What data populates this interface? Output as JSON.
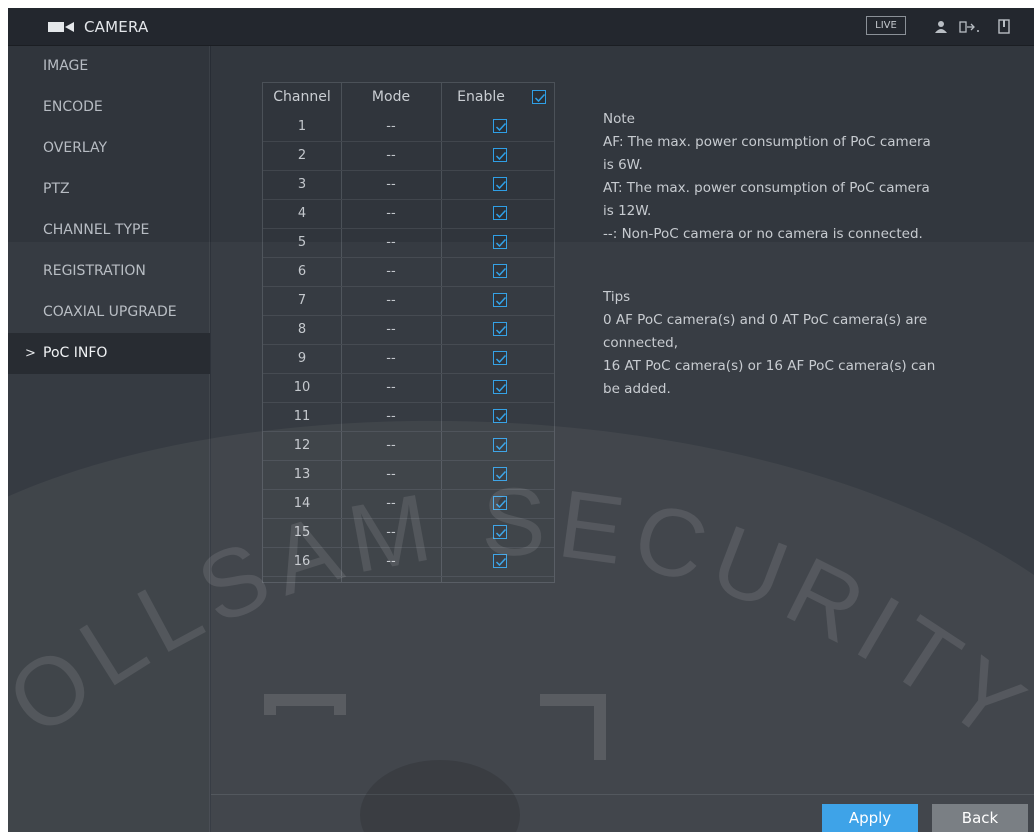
{
  "titlebar": {
    "title": "CAMERA",
    "live_label": "LIVE",
    "icons": [
      "camera-icon",
      "user-icon",
      "logout-icon",
      "exit-icon"
    ]
  },
  "sidebar": {
    "items": [
      {
        "label": "IMAGE",
        "active": false
      },
      {
        "label": "ENCODE",
        "active": false
      },
      {
        "label": "OVERLAY",
        "active": false
      },
      {
        "label": "PTZ",
        "active": false
      },
      {
        "label": "CHANNEL TYPE",
        "active": false
      },
      {
        "label": "REGISTRATION",
        "active": false
      },
      {
        "label": "COAXIAL UPGRADE",
        "active": false
      },
      {
        "label": "PoC INFO",
        "active": true
      }
    ],
    "active_chevron": ">"
  },
  "table": {
    "headers": {
      "channel": "Channel",
      "mode": "Mode",
      "enable": "Enable"
    },
    "enable_all": true,
    "rows": [
      {
        "channel": "1",
        "mode": "--",
        "enabled": true
      },
      {
        "channel": "2",
        "mode": "--",
        "enabled": true
      },
      {
        "channel": "3",
        "mode": "--",
        "enabled": true
      },
      {
        "channel": "4",
        "mode": "--",
        "enabled": true
      },
      {
        "channel": "5",
        "mode": "--",
        "enabled": true
      },
      {
        "channel": "6",
        "mode": "--",
        "enabled": true
      },
      {
        "channel": "7",
        "mode": "--",
        "enabled": true
      },
      {
        "channel": "8",
        "mode": "--",
        "enabled": true
      },
      {
        "channel": "9",
        "mode": "--",
        "enabled": true
      },
      {
        "channel": "10",
        "mode": "--",
        "enabled": true
      },
      {
        "channel": "11",
        "mode": "--",
        "enabled": true
      },
      {
        "channel": "12",
        "mode": "--",
        "enabled": true
      },
      {
        "channel": "13",
        "mode": "--",
        "enabled": true
      },
      {
        "channel": "14",
        "mode": "--",
        "enabled": true
      },
      {
        "channel": "15",
        "mode": "--",
        "enabled": true
      },
      {
        "channel": "16",
        "mode": "--",
        "enabled": true
      }
    ]
  },
  "note": {
    "heading": "Note",
    "af_line1": "AF: The max. power consumption of PoC camera",
    "af_line2": "is 6W.",
    "at_line1": "AT: The max. power consumption of PoC camera",
    "at_line2": "is 12W.",
    "non_poc": "--: Non-PoC camera or no camera is connected."
  },
  "tips": {
    "heading": "Tips",
    "line1": "0 AF PoC camera(s) and 0 AT PoC camera(s) are",
    "line2": "connected,",
    "line3": "16 AT PoC camera(s) or 16 AF PoC camera(s) can",
    "line4": "be added."
  },
  "footer": {
    "apply_label": "Apply",
    "back_label": "Back"
  },
  "watermark": {
    "text": "OLLSAM SECURITY"
  },
  "colors": {
    "accent": "#2e9be7",
    "panel": "#32373e",
    "sidebar": "#30353c",
    "titlebar": "#23272e",
    "back_button": "#6f747a"
  }
}
